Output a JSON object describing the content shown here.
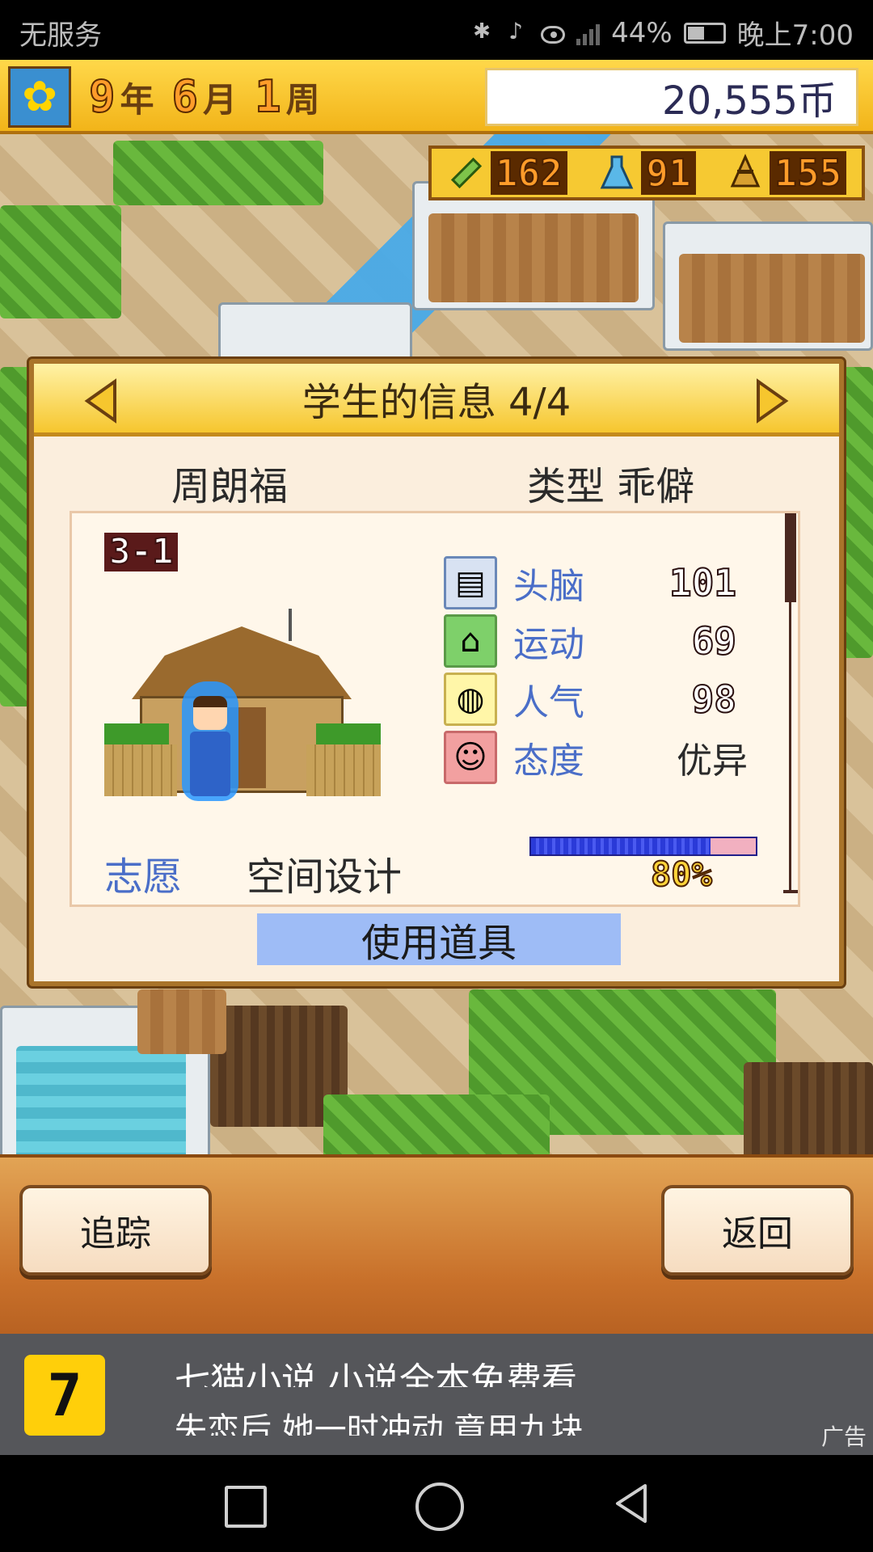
{
  "status_bar": {
    "carrier": "无服务",
    "battery": "44%",
    "time": "晚上7:00"
  },
  "hud": {
    "year": "9",
    "year_unit": "年",
    "month": "6",
    "month_unit": "月",
    "week": "1",
    "week_unit": "周",
    "money": "20,555币",
    "stats": [
      {
        "icon": "pencil-icon",
        "value": "162"
      },
      {
        "icon": "flask-icon",
        "value": "91"
      },
      {
        "icon": "cone-icon",
        "value": "155"
      }
    ]
  },
  "dialog": {
    "title": "学生的信息 4/4",
    "student_name": "周朗福",
    "type_text": "类型 乖僻",
    "class_tag": "3-1",
    "attributes": [
      {
        "icon": "brain-icon",
        "label": "头脑",
        "value": "101"
      },
      {
        "icon": "sport-icon",
        "label": "运动",
        "value": "69"
      },
      {
        "icon": "popularity-icon",
        "label": "人气",
        "value": "98"
      },
      {
        "icon": "attitude-icon",
        "label": "态度",
        "value": "优异"
      }
    ],
    "aspiration_label": "志愿",
    "aspiration_value": "空间设计",
    "aspiration_progress": 0.8,
    "aspiration_progress_text": "80%",
    "use_item_label": "使用道具"
  },
  "bottom_bar": {
    "track_label": "追踪",
    "back_label": "返回"
  },
  "ad": {
    "logo_text": "7",
    "line1": "七猫小说 小说全本免费看",
    "line2": "失恋后 她一时冲动 竟用九块",
    "tag": "广告"
  }
}
